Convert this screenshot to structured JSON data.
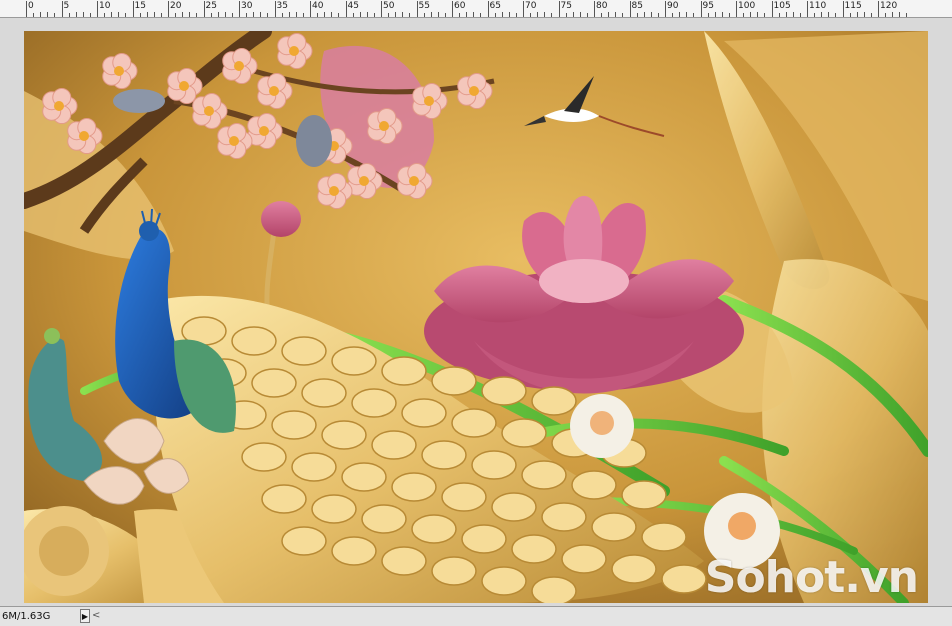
{
  "ruler": {
    "labels": [
      "0",
      "5",
      "10",
      "15",
      "20",
      "25",
      "30",
      "35",
      "40",
      "45",
      "50",
      "55",
      "60",
      "65",
      "70",
      "75",
      "80",
      "85",
      "90",
      "95",
      "100",
      "105",
      "110",
      "115",
      "120"
    ]
  },
  "artwork": {
    "subject": "golden-carved-peacock-lotus-mural",
    "colors": {
      "background": "#c99b3d",
      "gold": "#e8c777",
      "lotus": "#c9587d",
      "blossom": "#f4c6bb",
      "leaf": "#6ccf3a",
      "peacock_blue": "#1f5fae"
    }
  },
  "watermark": {
    "text": "Sohot.vn"
  },
  "status": {
    "doc_size": "6M/1.63G",
    "arrow_icon": "▶",
    "scroll_left_icon": "<"
  }
}
